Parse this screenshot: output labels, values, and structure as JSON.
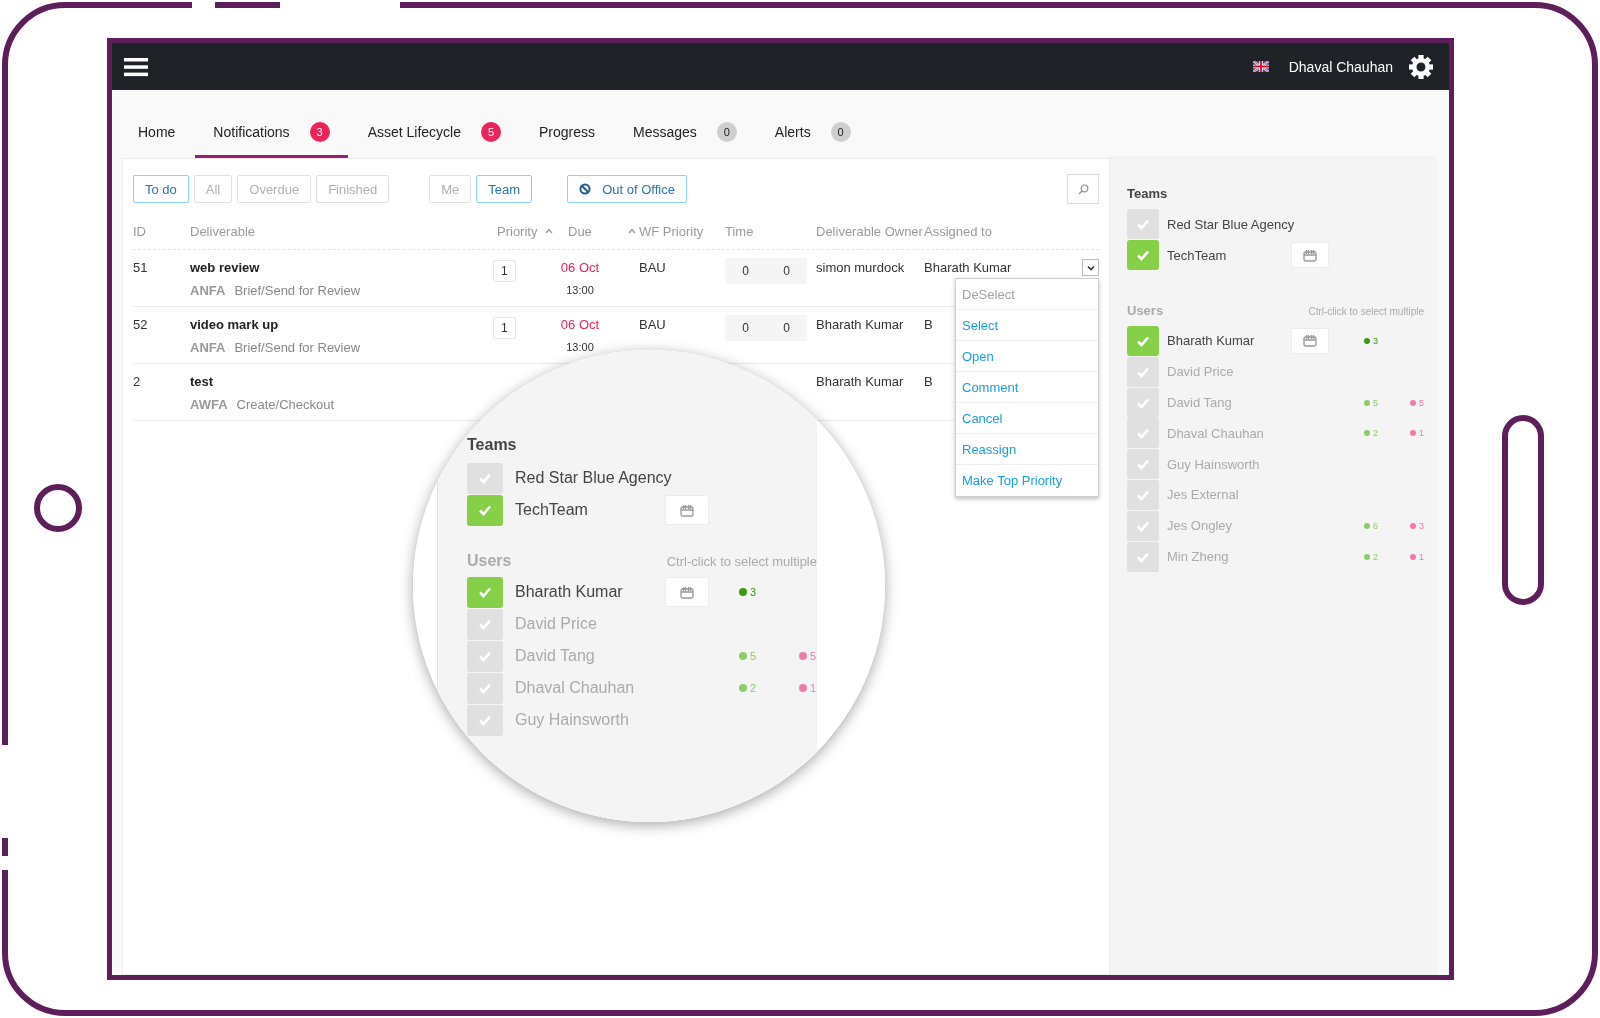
{
  "topbar": {
    "user": "Dhaval Chauhan"
  },
  "tabs": [
    {
      "label": "Home",
      "selected": false
    },
    {
      "label": "Notifications",
      "selected": true,
      "badge": {
        "text": "3",
        "kind": "alert"
      }
    },
    {
      "label": "Asset Lifecycle",
      "selected": false,
      "badge": {
        "text": "5",
        "kind": "alert"
      }
    },
    {
      "label": "Progress",
      "selected": false
    },
    {
      "label": "Messages",
      "selected": false,
      "badge": {
        "text": "0",
        "kind": "zero"
      }
    },
    {
      "label": "Alerts",
      "selected": false,
      "badge": {
        "text": "0",
        "kind": "zero"
      }
    }
  ],
  "filters": [
    {
      "label": "To do",
      "selected": true
    },
    {
      "label": "All",
      "selected": false
    },
    {
      "label": "Overdue",
      "selected": false
    },
    {
      "label": "Finished",
      "selected": false
    }
  ],
  "scope": [
    {
      "label": "Me",
      "selected": false
    },
    {
      "label": "Team",
      "selected": true
    }
  ],
  "out_of_office": {
    "label": "Out of Office"
  },
  "table": {
    "columns": [
      {
        "label": "ID",
        "sortable": false
      },
      {
        "label": "Deliverable",
        "sortable": false
      },
      {
        "label": "Priority",
        "sortable": true
      },
      {
        "label": "Due",
        "sortable": true
      },
      {
        "label": "WF Priority",
        "sortable": false
      },
      {
        "label": "Time",
        "sortable": false
      },
      {
        "label": "Deliverable Owner",
        "sortable": false
      },
      {
        "label": "Assigned to",
        "sortable": false
      }
    ],
    "rows": [
      {
        "id": "51",
        "title": "web review",
        "code": "ANFA",
        "stage": "Brief/Send for Review",
        "priority": "1",
        "due_date": "06 Oct",
        "due_time": "13:00",
        "wf_priority": "BAU",
        "time": [
          "0",
          "0"
        ],
        "owner": "simon murdock",
        "assigned": "Bharath Kumar"
      },
      {
        "id": "52",
        "title": "video mark up",
        "code": "ANFA",
        "stage": "Brief/Send for Review",
        "priority": "1",
        "due_date": "06 Oct",
        "due_time": "13:00",
        "wf_priority": "BAU",
        "time": [
          "0",
          "0"
        ],
        "owner": "Bharath Kumar",
        "assigned": "B"
      },
      {
        "id": "2",
        "title": "test",
        "code": "AWFA",
        "stage": "Create/Checkout",
        "owner": "Bharath Kumar",
        "assigned": "B"
      }
    ]
  },
  "row_menu": {
    "items": [
      {
        "label": "DeSelect",
        "disabled": true
      },
      {
        "label": "Select",
        "disabled": false
      },
      {
        "label": "Open",
        "disabled": false
      },
      {
        "label": "Comment",
        "disabled": false
      },
      {
        "label": "Cancel",
        "disabled": false
      },
      {
        "label": "Reassign",
        "disabled": false
      },
      {
        "label": "Make Top Priority",
        "disabled": false
      }
    ]
  },
  "panel": {
    "teams_title": "Teams",
    "teams": [
      {
        "name": "Red Star Blue Agency",
        "selected": false
      },
      {
        "name": "TechTeam",
        "selected": true
      }
    ],
    "users_title": "Users",
    "hint": "Ctrl-click to select multiple",
    "users": [
      {
        "name": "Bharath Kumar",
        "selected": true,
        "counts": [
          {
            "value": "3",
            "kind": "done"
          }
        ]
      },
      {
        "name": "David Price",
        "selected": false
      },
      {
        "name": "David Tang",
        "selected": false,
        "counts": [
          {
            "value": "5",
            "kind": "done"
          },
          {
            "value": "5",
            "kind": "late"
          }
        ]
      },
      {
        "name": "Dhaval Chauhan",
        "selected": false,
        "counts": [
          {
            "value": "2",
            "kind": "done"
          },
          {
            "value": "1",
            "kind": "late"
          }
        ]
      },
      {
        "name": "Guy Hainsworth",
        "selected": false
      },
      {
        "name": "Jes External",
        "selected": false
      },
      {
        "name": "Jes Ongley",
        "selected": false,
        "counts": [
          {
            "value": "6",
            "kind": "done"
          },
          {
            "value": "3",
            "kind": "late"
          }
        ]
      },
      {
        "name": "Min Zheng",
        "selected": false,
        "counts": [
          {
            "value": "2",
            "kind": "done"
          },
          {
            "value": "1",
            "kind": "late"
          }
        ]
      }
    ]
  },
  "magnifier": {
    "teams_title": "Teams",
    "teams": [
      {
        "name": "Red Star Blue Agency",
        "selected": false
      },
      {
        "name": "TechTeam",
        "selected": true
      }
    ],
    "users_title": "Users",
    "hint": "Ctrl-click to select multiple",
    "users": [
      {
        "name": "Bharath Kumar",
        "selected": true,
        "counts": [
          {
            "value": "3",
            "kind": "done"
          }
        ]
      },
      {
        "name": "David Price",
        "selected": false
      },
      {
        "name": "David Tang",
        "selected": false,
        "counts": [
          {
            "value": "5",
            "kind": "done"
          },
          {
            "value": "5",
            "kind": "late"
          }
        ]
      },
      {
        "name": "Dhaval Chauhan",
        "selected": false,
        "counts": [
          {
            "value": "2",
            "kind": "done"
          },
          {
            "value": "1",
            "kind": "late"
          }
        ]
      },
      {
        "name": "Guy Hainsworth",
        "selected": false
      }
    ]
  }
}
